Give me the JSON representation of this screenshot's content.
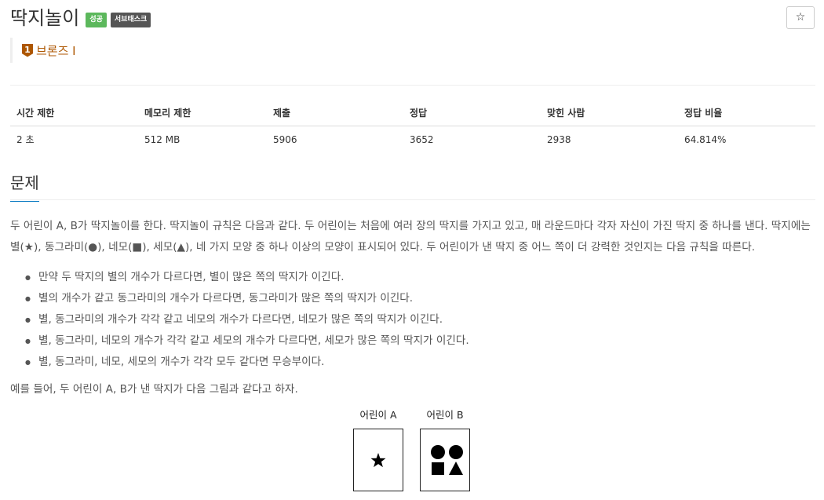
{
  "problem": {
    "title": "딱지놀이",
    "labels": {
      "status": "성공",
      "category": "서브태스크"
    },
    "star_glyph": "☆",
    "tier": {
      "number": "1",
      "text": "브론즈 I",
      "color": "#ad5600"
    }
  },
  "stats": {
    "headers": [
      "시간 제한",
      "메모리 제한",
      "제출",
      "정답",
      "맞힌 사람",
      "정답 비율"
    ],
    "values": [
      "2 초",
      "512 MB",
      "5906",
      "3652",
      "2938",
      "64.814%"
    ]
  },
  "section": {
    "title": "문제"
  },
  "body": {
    "intro": "두 어린이 A, B가 딱지놀이를 한다. 딱지놀이 규칙은 다음과 같다. 두 어린이는 처음에 여러 장의 딱지를 가지고 있고, 매 라운드마다 각자 자신이 가진 딱지 중 하나를 낸다. 딱지에는 별(★), 동그라미(●), 네모(■), 세모(▲), 네 가지 모양 중 하나 이상의 모양이 표시되어 있다. 두 어린이가 낸 딱지 중 어느 쪽이 더 강력한 것인지는 다음 규칙을 따른다.",
    "rules": [
      "만약 두 딱지의 별의 개수가 다르다면, 별이 많은 쪽의 딱지가 이긴다.",
      "별의 개수가 같고 동그라미의 개수가 다르다면, 동그라미가 많은 쪽의 딱지가 이긴다.",
      "별, 동그라미의 개수가 각각 같고 네모의 개수가 다르다면, 네모가 많은 쪽의 딱지가 이긴다.",
      "별, 동그라미, 네모의 개수가 각각 같고 세모의 개수가 다르다면, 세모가 많은 쪽의 딱지가 이긴다.",
      "별, 동그라미, 네모, 세모의 개수가 각각 모두 같다면 무승부이다."
    ],
    "example": "예를 들어, 두 어린이 A, B가 낸 딱지가 다음 그림과 같다고 하자."
  },
  "figure": {
    "card_a": {
      "label": "어린이 A",
      "shapes": [
        "star"
      ]
    },
    "card_b": {
      "label": "어린이 B",
      "shapes": [
        "circle",
        "circle",
        "square",
        "triangle"
      ]
    }
  }
}
